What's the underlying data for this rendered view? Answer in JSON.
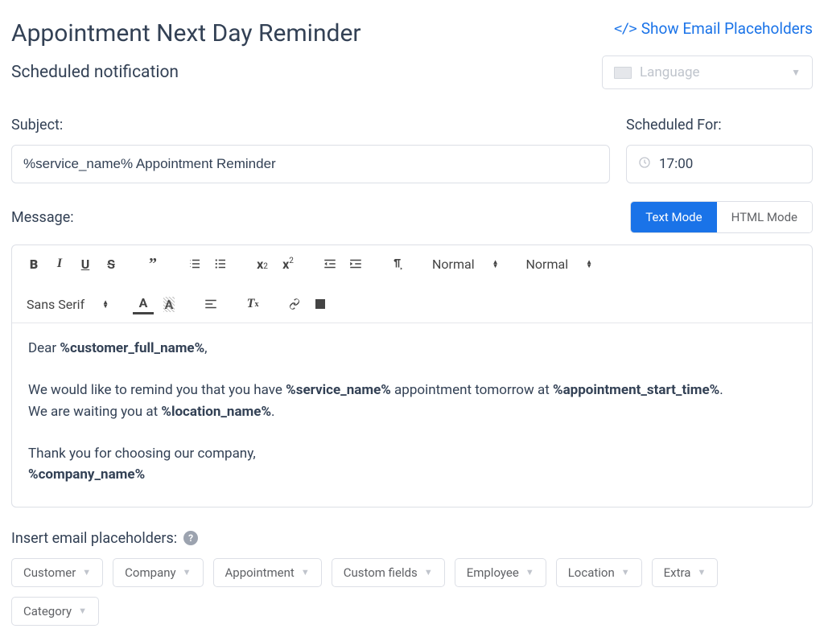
{
  "header": {
    "title": "Appointment Next Day Reminder",
    "show_placeholders": "Show Email Placeholders",
    "subtitle": "Scheduled notification",
    "language_placeholder": "Language"
  },
  "fields": {
    "subject_label": "Subject:",
    "subject_value": "%service_name% Appointment Reminder",
    "scheduled_label": "Scheduled For:",
    "scheduled_value": "17:00"
  },
  "message": {
    "label": "Message:",
    "text_mode": "Text Mode",
    "html_mode": "HTML Mode"
  },
  "toolbar": {
    "heading": "Normal",
    "size": "Normal",
    "font": "Sans Serif"
  },
  "body": {
    "line1_a": "Dear ",
    "line1_b": "%customer_full_name%",
    "line1_c": ",",
    "line2_a": "We would like to remind you that you have ",
    "line2_b": "%service_name%",
    "line2_c": " appointment tomorrow at ",
    "line2_d": "%appointment_start_time%",
    "line2_e": ".",
    "line3_a": "We are waiting you at ",
    "line3_b": "%location_name%",
    "line3_c": ".",
    "line4": "Thank you for choosing our company,",
    "line5": "%company_name%"
  },
  "insert": {
    "label": "Insert email placeholders:",
    "buttons": [
      "Customer",
      "Company",
      "Appointment",
      "Custom fields",
      "Employee",
      "Location",
      "Extra",
      "Category"
    ]
  }
}
